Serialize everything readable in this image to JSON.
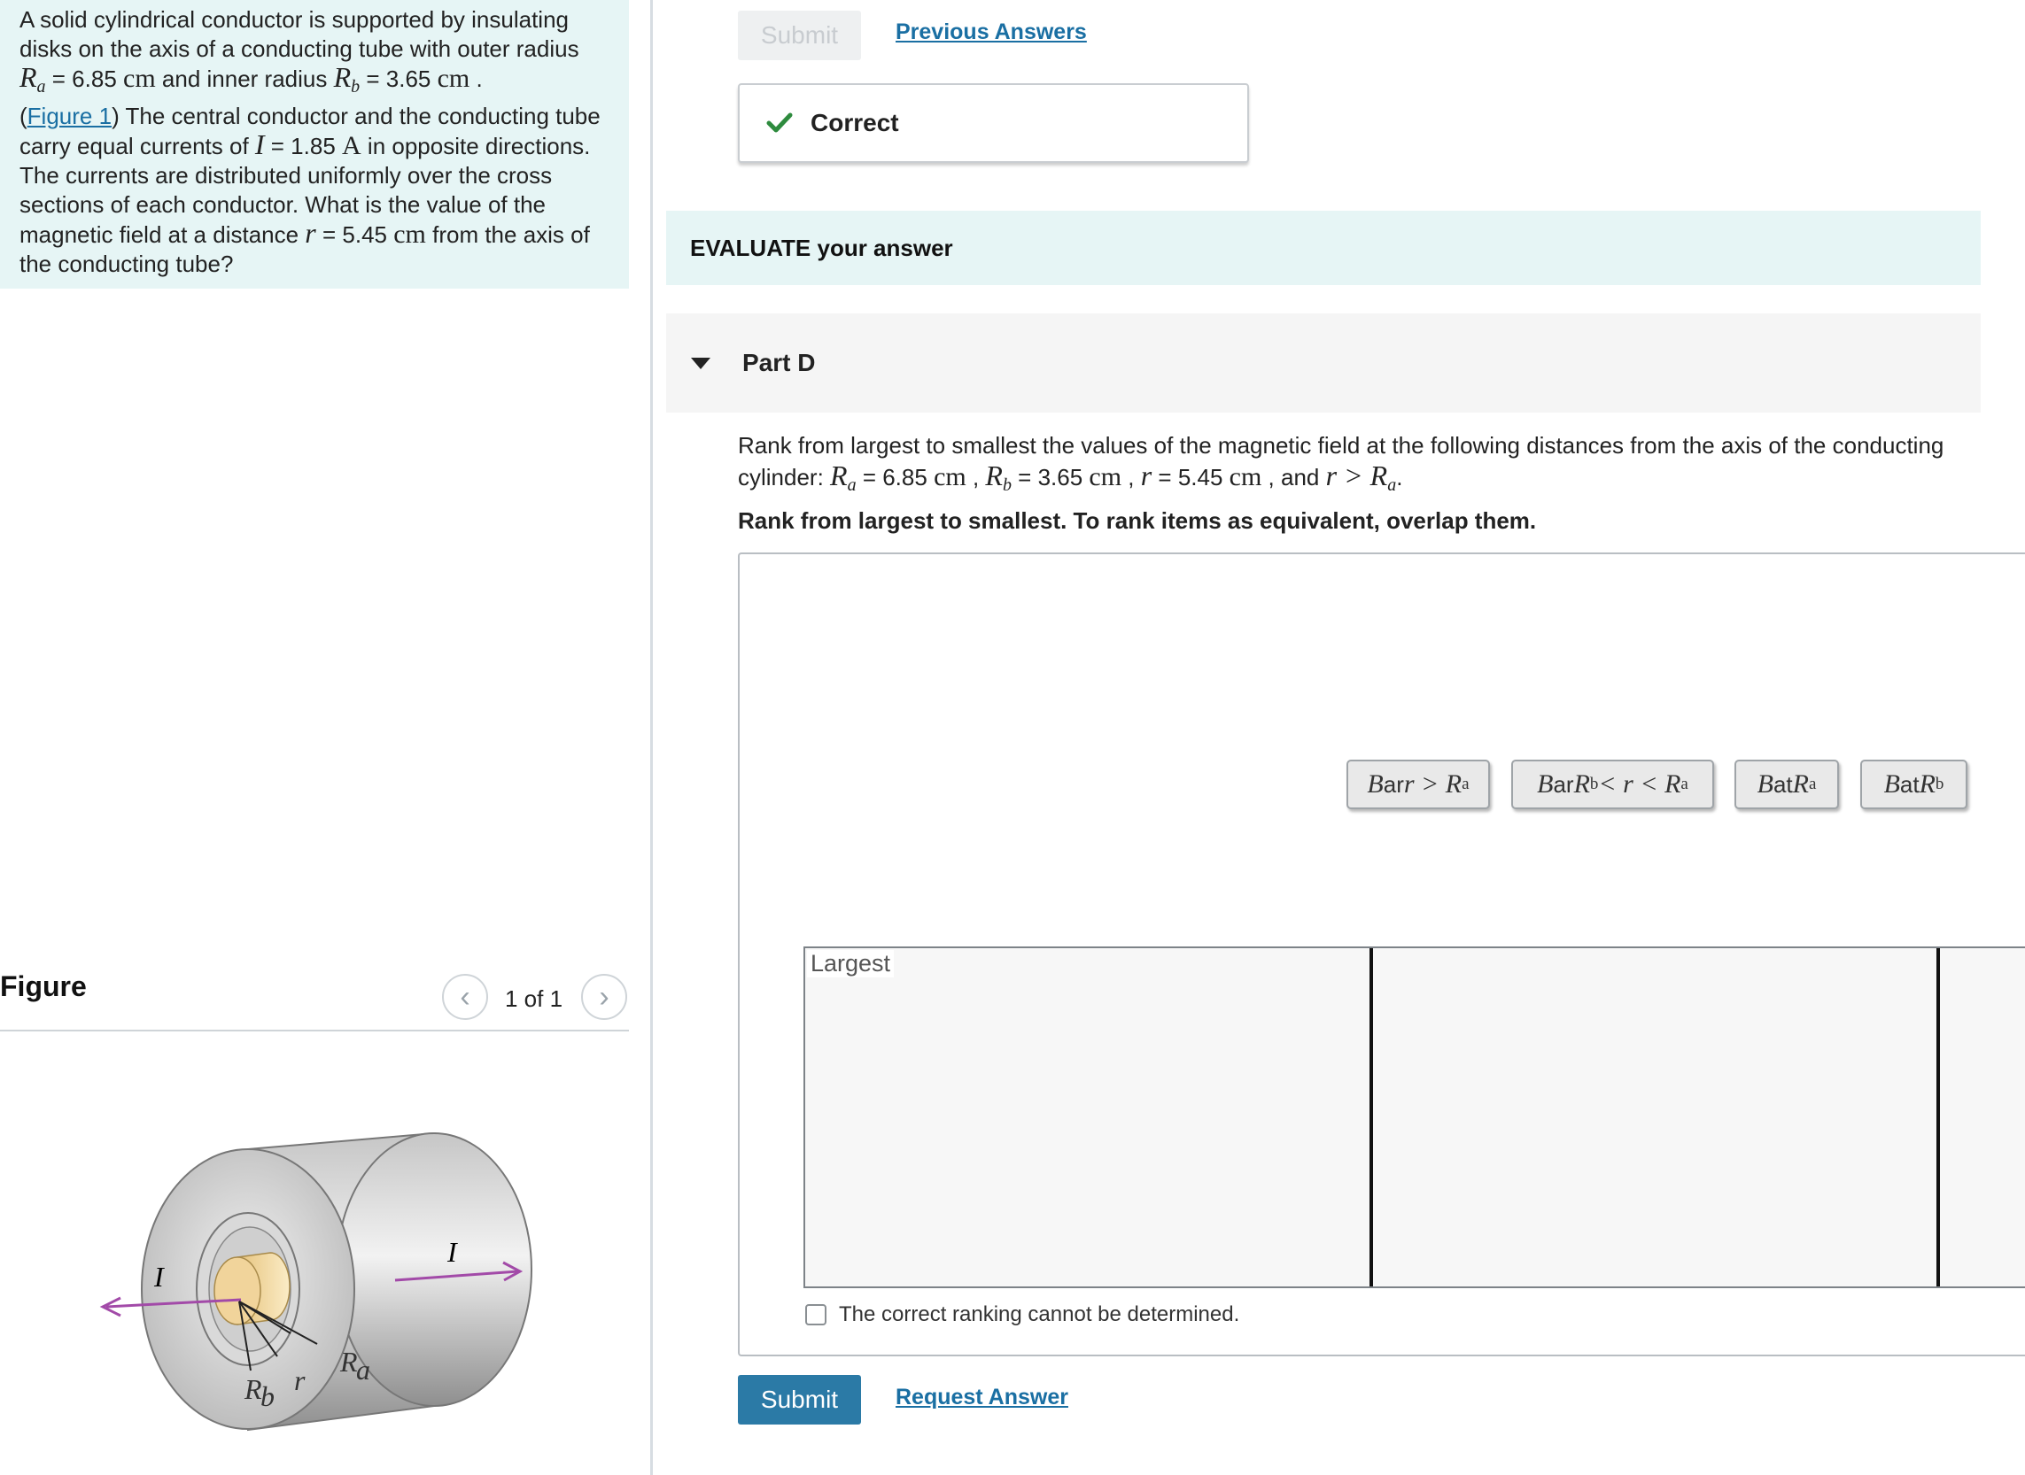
{
  "problem": {
    "line1": "A solid cylindrical conductor is supported by insulating",
    "line2": "disks on the axis of a conducting tube with outer radius",
    "Ra_sym": "R",
    "Ra_sub": "a",
    "Ra_value": " = 6.85 ",
    "Ra_unit": "cm",
    "and_inner": " and inner radius ",
    "Rb_sym": "R",
    "Rb_sub": "b",
    "Rb_value": " = 3.65 ",
    "Rb_unit": "cm",
    "period": " .",
    "open_paren": "(",
    "figure_link": "Figure 1",
    "after_link": ") The central conductor and the conducting tube",
    "carry": "carry equal currents of ",
    "I_sym": "I",
    "I_value": " = 1.85 ",
    "I_unit": "A",
    "opposite": " in opposite directions.",
    "line6": "The currents are distributed uniformly over the cross",
    "line7": "sections of each conductor. What is the value of the",
    "field_at": "magnetic field at a distance ",
    "r_sym": "r",
    "r_value": " = 5.45 ",
    "r_unit": "cm",
    "from_axis": " from the axis of",
    "line9": "the conducting tube?"
  },
  "figure_panel": {
    "title": "Figure",
    "prev_icon": "‹",
    "next_icon": "›",
    "count": "1 of 1",
    "labels": {
      "I_left": "I",
      "I_right": "I",
      "Ra": "R",
      "Ra_sub": "a",
      "Rb": "R",
      "Rb_sub": "b",
      "r": "r"
    }
  },
  "answer_controls": {
    "submit_label": "Submit",
    "previous_answers": "Previous Answers",
    "feedback": "Correct",
    "feedback_icon": "check-icon"
  },
  "evaluate_banner": "EVALUATE your answer",
  "part": {
    "title": "Part D",
    "question_line1": "Rank from largest to smallest the values of the magnetic field at the following distances from the axis of the conducting",
    "q_cylinder": "cylinder: ",
    "q_Ra_sym": "R",
    "q_Ra_sub": "a",
    "q_Ra_value": " = 6.85 ",
    "q_Ra_unit": "cm",
    "q_comma1": " , ",
    "q_Rb_sym": "R",
    "q_Rb_sub": "b",
    "q_Rb_value": " = 3.65 ",
    "q_Rb_unit": "cm",
    "q_comma2": " , ",
    "q_r_sym": "r",
    "q_r_value": " = 5.45 ",
    "q_r_unit": "cm",
    "q_and": " , and ",
    "q_ineq": "r > R",
    "q_ineq_sub": "a",
    "q_end": ".",
    "instructions": "Rank from largest to smallest. To rank items as equivalent, overlap them.",
    "items": [
      {
        "B": "B",
        "mid": " ar ",
        "expr": "r > R",
        "sub": "a",
        "tail": ""
      },
      {
        "B": "B",
        "mid": " ar ",
        "expr": "R",
        "sub": "b",
        "tail": " < r < R",
        "sub2": "a"
      },
      {
        "B": "B",
        "mid": " at ",
        "expr": "R",
        "sub": "a",
        "tail": ""
      },
      {
        "B": "B",
        "mid": " at ",
        "expr": "R",
        "sub": "b",
        "tail": ""
      }
    ],
    "largest_label": "Largest",
    "cannot_determine": "The correct ranking cannot be determined.",
    "submit_label": "Submit",
    "request_answer": "Request Answer"
  },
  "colors": {
    "panel_bg": "#e6f5f5",
    "link": "#1a6fa3",
    "submit_bg": "#2b7aa6",
    "check": "#2e8b3e",
    "arrow": "#a24aa8"
  }
}
